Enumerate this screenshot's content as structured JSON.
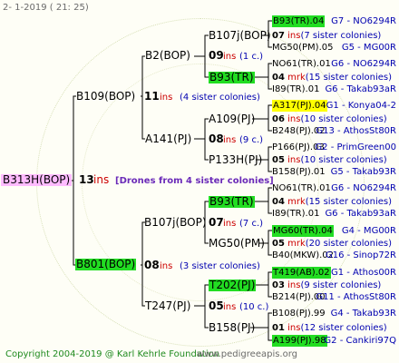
{
  "header": {
    "date_line": "2-   1-2019  ( 21:  25)"
  },
  "root": {
    "name": "B313H(BOP)",
    "num": "13",
    "ins": "ins",
    "drones": "[Drones from 4 sister colonies]"
  },
  "gen1": [
    {
      "name": "B109(BOP)",
      "num": "11",
      "ins": "ins",
      "sisters": "(4 sister colonies)"
    },
    {
      "name": "B801(BOP)",
      "num": "08",
      "ins": "ins",
      "sisters": "(3 sister colonies)"
    }
  ],
  "gen2": [
    {
      "name": "B2(BOP)",
      "num": "09",
      "ins": "ins",
      "sisters": "(1 c.)"
    },
    {
      "name": "A141(PJ)",
      "num": "08",
      "ins": "ins",
      "sisters": "(9 c.)"
    },
    {
      "name": "B107j(BOP)",
      "num": "07",
      "ins": "ins",
      "sisters": "(7 c.)"
    },
    {
      "name": "T247(PJ)",
      "num": "05",
      "ins": "ins",
      "sisters": "(10 c.)"
    }
  ],
  "gen3": [
    {
      "name": "B107j(BOP)",
      "num": "07",
      "ins": "ins",
      "sisters": "(7 sister colonies)"
    },
    {
      "name": "B93(TR)",
      "num": "04",
      "ins": "mrk",
      "sisters": "(15 sister colonies)"
    },
    {
      "name": "A109(PJ)",
      "num": "06",
      "ins": "ins",
      "sisters": "(10 sister colonies)"
    },
    {
      "name": "P133H(PJ)",
      "num": "05",
      "ins": "ins",
      "sisters": "(10 sister colonies)"
    },
    {
      "name": "B93(TR)",
      "num": "04",
      "ins": "mrk",
      "sisters": "(15 sister colonies)"
    },
    {
      "name": "MG50(PM)",
      "num": "05",
      "ins": "mrk",
      "sisters": "(20 sister colonies)"
    },
    {
      "name": "T202(PJ)",
      "num": "03",
      "ins": "ins",
      "sisters": "(9 sister colonies)"
    },
    {
      "name": "B158(PJ)",
      "num": "01",
      "ins": "ins",
      "sisters": "(12 sister colonies)"
    }
  ],
  "gen4": [
    {
      "name": "B93(TR).04",
      "ref": "G7 - NO6294R"
    },
    {
      "name": "MG50(PM).05",
      "ref": "G5 - MG00R"
    },
    {
      "name": "NO61(TR).01",
      "ref": "G6 - NO6294R"
    },
    {
      "name": "I89(TR).01",
      "ref": "G6 - Takab93aR"
    },
    {
      "name": "A317(PJ).04",
      "ref": "G1 - Konya04-2"
    },
    {
      "name": "B248(PJ).02",
      "ref": "G13 - AthosSt80R"
    },
    {
      "name": "P166(PJ).03",
      "ref": "G2 - PrimGreen00"
    },
    {
      "name": "B158(PJ).01",
      "ref": "G5 - Takab93R"
    },
    {
      "name": "NO61(TR).01",
      "ref": "G6 - NO6294R"
    },
    {
      "name": "I89(TR).01",
      "ref": "G6 - Takab93aR"
    },
    {
      "name": "MG60(TR).04",
      "ref": "G4 - MG00R"
    },
    {
      "name": "B40(MKW).02",
      "ref": "G16 - Sinop72R"
    },
    {
      "name": "T419(AB).02",
      "ref": "G1 - Athos00R"
    },
    {
      "name": "B214(PJ).00",
      "ref": "G11 - AthosSt80R"
    },
    {
      "name": "B108(PJ).99",
      "ref": "G4 - Takab93R"
    },
    {
      "name": "A199(PJ).98",
      "ref": "G2 - Cankiri97Q"
    }
  ],
  "footer": {
    "copyright": "Copyright 2004-2019 @ Karl Kehrle Foundation",
    "site": "www.pedigreeapis.org"
  },
  "colors": {
    "line": "#000000",
    "green": "#22dd22",
    "yellow": "#ffff00",
    "pink": "#ffbbff",
    "red": "#cc0000",
    "blue": "#0000b0",
    "purple": "#6a2ab8"
  }
}
